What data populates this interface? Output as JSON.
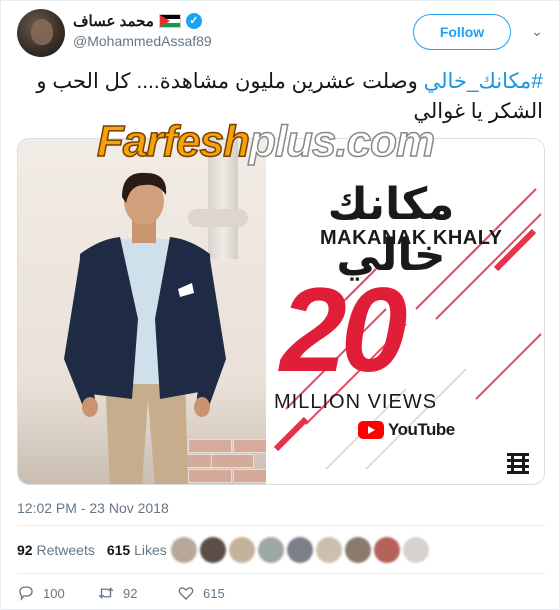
{
  "user": {
    "display_name": "محمد عساف",
    "handle": "@MohammedAssaf89",
    "verified": true,
    "flag": "palestine-flag"
  },
  "follow_label": "Follow",
  "tweet": {
    "hashtag": "#مكانك_خالي",
    "text": " وصلت عشرين مليون مشاهدة.... كل الحب و الشكر يا غوالي"
  },
  "watermark": {
    "part1": "Farfesh",
    "part2": "plus.com"
  },
  "poster": {
    "title_ar": "مكانك خالي",
    "title_en": "MAKANAK KHALY",
    "big_number": "20",
    "million_label": "MILLION VIEWS",
    "youtube_label": "YouTube"
  },
  "timestamp": "12:02 PM - 23 Nov 2018",
  "stats": {
    "retweets_count": "92",
    "retweets_label": "Retweets",
    "likes_count": "615",
    "likes_label": "Likes"
  },
  "actions": {
    "reply_count": "100",
    "retweet_count": "92",
    "like_count": "615"
  },
  "colors": {
    "accent": "#1da1f2",
    "hashtag": "#1b95e0",
    "poster_red": "#e01e37",
    "watermark_orange": "#f4a30b"
  }
}
